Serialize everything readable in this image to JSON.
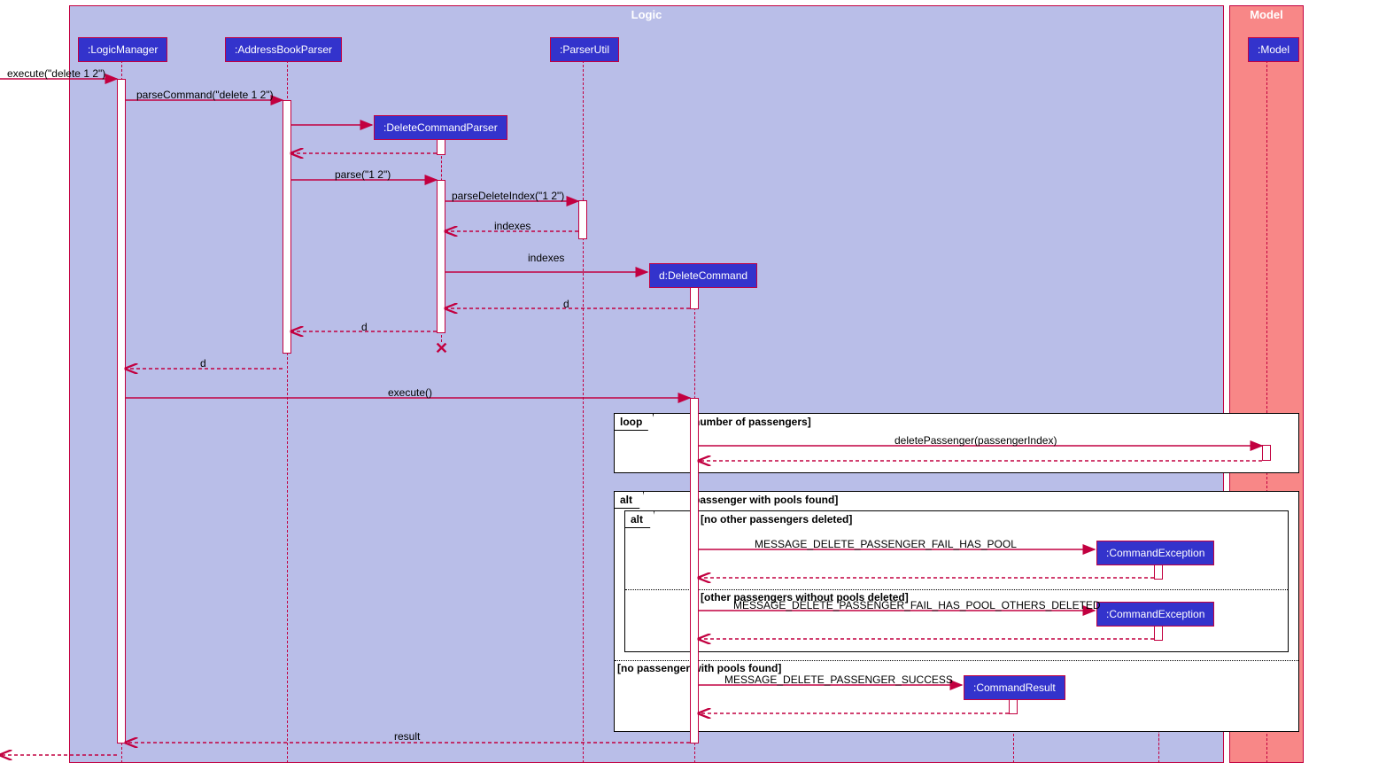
{
  "frames": {
    "logic": "Logic",
    "model": "Model"
  },
  "objects": {
    "logicManager": ":LogicManager",
    "addressBookParser": ":AddressBookParser",
    "parserUtil": ":ParserUtil",
    "deleteCommandParser": ":DeleteCommandParser",
    "deleteCommand": "d:DeleteCommand",
    "model": ":Model",
    "commandException1": ":CommandException",
    "commandException2": ":CommandException",
    "commandResult": ":CommandResult"
  },
  "messages": {
    "execute_delete": "execute(\"delete 1 2\")",
    "parseCommand": "parseCommand(\"delete 1 2\")",
    "parse": "parse(\"1 2\")",
    "parseDeleteIndex": "parseDeleteIndex(\"1 2\")",
    "indexes": "indexes",
    "indexes2": "indexes",
    "d": "d",
    "d2": "d",
    "d3": "d",
    "execute": "execute()",
    "deletePassenger": "deletePassenger(passengerIndex)",
    "msgFailHasPool": "MESSAGE_DELETE_PASSENGER_FAIL_HAS_POOL",
    "msgFailHasPoolOthers": "MESSAGE_DELETE_PASSENGER_FAIL_HAS_POOL_OTHERS_DELETED",
    "msgSuccess": "MESSAGE_DELETE_PASSENGER_SUCCESS",
    "result": "result"
  },
  "fragments": {
    "loop": {
      "label": "loop",
      "guard": "[number of passengers]"
    },
    "alt1": {
      "label": "alt",
      "guard1": "[passenger with pools found]",
      "guard3": "[no passenger with pools found]"
    },
    "alt2": {
      "label": "alt",
      "guard1": "[no other passengers deleted]",
      "guard2": "[other passengers without pools deleted]"
    }
  }
}
